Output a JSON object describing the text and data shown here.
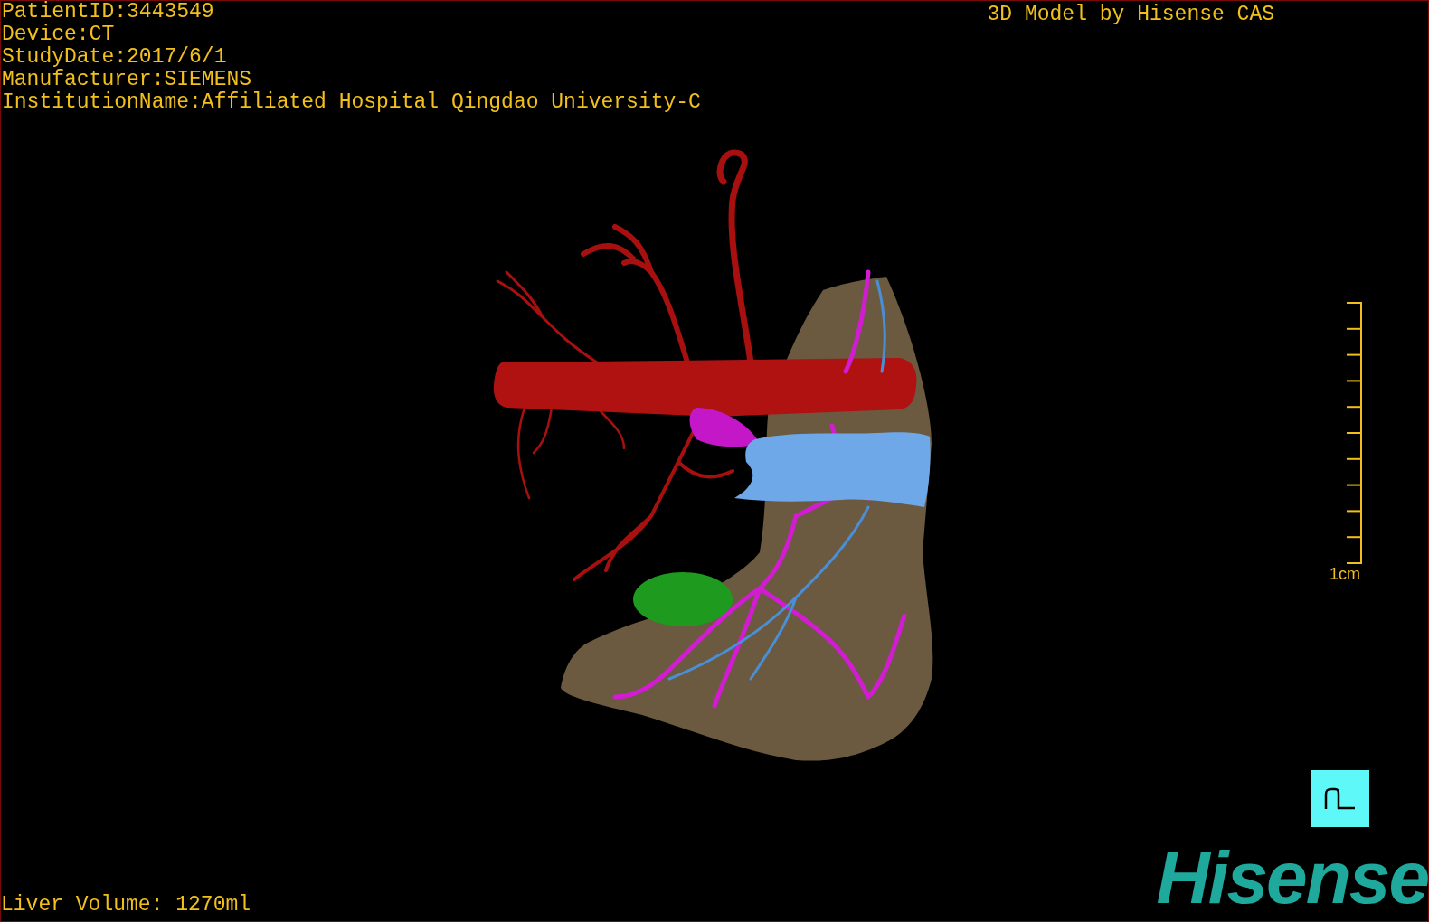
{
  "study_info": [
    "PatientID:3443549",
    "Device:CT",
    "StudyDate:2017/6/1",
    "Manufacturer:SIEMENS",
    "InstitutionName:Affiliated Hospital Qingdao University-C"
  ],
  "model_credit": "3D Model by Hisense CAS",
  "scale_bar": {
    "label": "1cm"
  },
  "liver_volume": "Liver Volume: 1270ml",
  "logo": "Hisense"
}
